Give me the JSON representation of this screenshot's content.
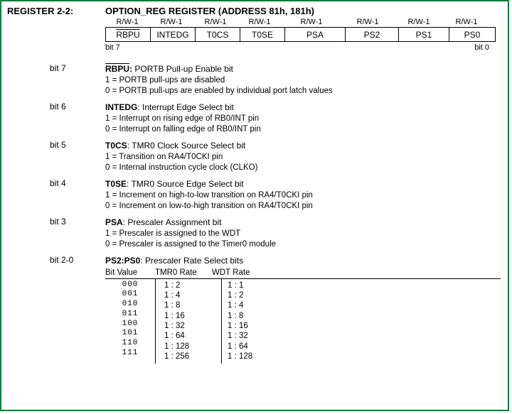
{
  "header": {
    "label": "REGISTER 2-2:",
    "title": "OPTION_REG REGISTER (ADDRESS 81h, 181h)"
  },
  "register": {
    "rw": [
      "R/W-1",
      "R/W-1",
      "R/W-1",
      "R/W-1",
      "R/W-1",
      "R/W-1",
      "R/W-1",
      "R/W-1"
    ],
    "names": [
      "RBPU",
      "INTEDG",
      "T0CS",
      "T0SE",
      "PSA",
      "PS2",
      "PS1",
      "PS0"
    ],
    "bit_hi": "bit 7",
    "bit_lo": "bit 0"
  },
  "bits": [
    {
      "label": "bit 7",
      "name": "RBPU:",
      "overline": true,
      "suffix": " PORTB Pull-up Enable bit",
      "vals": [
        "1 = PORTB pull-ups are disabled",
        "0 = PORTB pull-ups are enabled by individual port latch values"
      ]
    },
    {
      "label": "bit 6",
      "name": "INTEDG",
      "overline": false,
      "suffix": ": Interrupt Edge Select bit",
      "vals": [
        "1 = Interrupt on rising edge of RB0/INT pin",
        "0 = Interrupt on falling edge of RB0/INT pin"
      ]
    },
    {
      "label": "bit 5",
      "name": "T0CS",
      "overline": false,
      "suffix": ": TMR0 Clock Source Select bit",
      "vals": [
        "1 = Transition on RA4/T0CKI pin",
        "0 = Internal instruction cycle clock (CLKO)"
      ]
    },
    {
      "label": "bit 4",
      "name": "T0SE",
      "overline": false,
      "suffix": ": TMR0 Source Edge Select bit",
      "vals": [
        "1 = Increment on high-to-low transition on RA4/T0CKI pin",
        "0 = Increment on low-to-high transition on RA4/T0CKI pin"
      ]
    },
    {
      "label": "bit 3",
      "name": "PSA",
      "overline": false,
      "suffix": ": Prescaler Assignment bit",
      "vals": [
        "1 = Prescaler is assigned to the WDT",
        "0 = Prescaler is assigned to the Timer0 module"
      ]
    },
    {
      "label": "bit 2-0",
      "name": "PS2:PS0",
      "overline": false,
      "suffix": ": Prescaler Rate Select bits",
      "vals": []
    }
  ],
  "prescaler": {
    "headers": [
      "Bit Value",
      "TMR0 Rate",
      "WDT Rate"
    ],
    "rows": [
      {
        "bv": "000",
        "tmr": "1 : 2",
        "wdt": "1 : 1"
      },
      {
        "bv": "001",
        "tmr": "1 : 4",
        "wdt": "1 : 2"
      },
      {
        "bv": "010",
        "tmr": "1 : 8",
        "wdt": "1 : 4"
      },
      {
        "bv": "011",
        "tmr": "1 : 16",
        "wdt": "1 : 8"
      },
      {
        "bv": "100",
        "tmr": "1 : 32",
        "wdt": "1 : 16"
      },
      {
        "bv": "101",
        "tmr": "1 : 64",
        "wdt": "1 : 32"
      },
      {
        "bv": "110",
        "tmr": "1 : 128",
        "wdt": "1 : 64"
      },
      {
        "bv": "111",
        "tmr": "1 : 256",
        "wdt": "1 : 128"
      }
    ]
  }
}
